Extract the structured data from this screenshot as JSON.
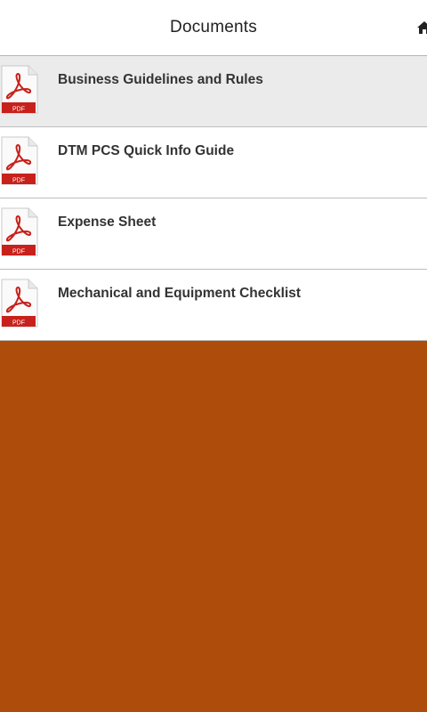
{
  "header": {
    "title": "Documents",
    "home_icon": "home-icon"
  },
  "documents": [
    {
      "label": "Business Guidelines and Rules",
      "icon": "pdf-icon",
      "badge": "PDF",
      "selected": true
    },
    {
      "label": "DTM PCS Quick Info Guide",
      "icon": "pdf-icon",
      "badge": "PDF",
      "selected": false
    },
    {
      "label": "Expense Sheet",
      "icon": "pdf-icon",
      "badge": "PDF",
      "selected": false
    },
    {
      "label": "Mechanical and Equipment Checklist",
      "icon": "pdf-icon",
      "badge": "PDF",
      "selected": false
    }
  ],
  "colors": {
    "background": "#ad4c0b",
    "selected_row": "#ebebeb",
    "pdf_red": "#c8211b"
  }
}
